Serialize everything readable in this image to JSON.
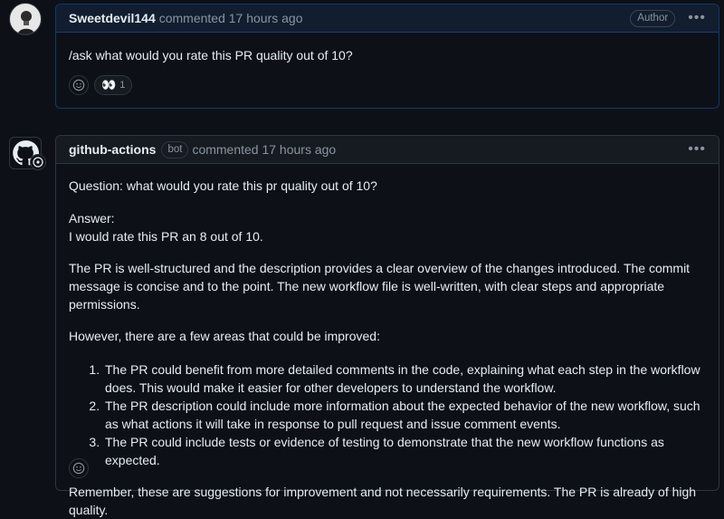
{
  "comment1": {
    "author": "Sweetdevil144",
    "meta": "commented 17 hours ago",
    "role_badge": "Author",
    "body": "/ask what would you rate this PR quality out of 10?",
    "reaction_emoji": "👀",
    "reaction_count": "1"
  },
  "comment2": {
    "author": "github-actions",
    "bot_tag": "bot",
    "meta": "commented 17 hours ago",
    "question": "Question: what would you rate this pr quality out of 10?",
    "answer_label": "Answer:",
    "answer": "I would rate this PR an 8 out of 10.",
    "para1": "The PR is well-structured and the description provides a clear overview of the changes introduced. The commit message is concise and to the point. The new workflow file is well-written, with clear steps and appropriate permissions.",
    "para2": "However, there are a few areas that could be improved:",
    "items": [
      "The PR could benefit from more detailed comments in the code, explaining what each step in the workflow does. This would make it easier for other developers to understand the workflow.",
      "The PR description could include more information about the expected behavior of the new workflow, such as what actions it will take in response to pull request and issue comment events.",
      "The PR could include tests or evidence of testing to demonstrate that the new workflow functions as expected."
    ],
    "closing": "Remember, these are suggestions for improvement and not necessarily requirements. The PR is already of high quality."
  },
  "icons": {
    "kebab": "kebab-horizontal-icon",
    "smiley": "smiley-icon",
    "github": "github-mark-icon"
  }
}
